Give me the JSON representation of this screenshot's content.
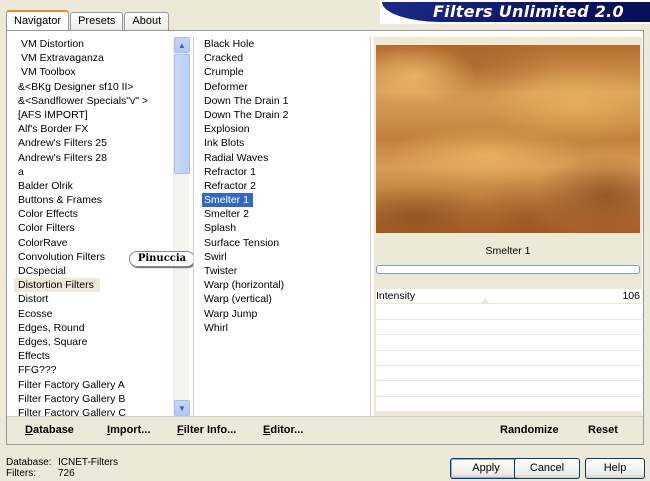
{
  "tabs": [
    "Navigator",
    "Presets",
    "About"
  ],
  "banner": "Filters Unlimited 2.0",
  "categories": [
    "VM Distortion",
    "VM Extravaganza",
    "VM Toolbox",
    "&<BKg Designer sf10 II>",
    "&<Sandflower Specials\"v\" >",
    "[AFS IMPORT]",
    "Alf's Border FX",
    "Andrew's Filters 25",
    "Andrew's Filters 28",
    "a",
    "Balder Olrik",
    "Buttons & Frames",
    "Color Effects",
    "Color Filters",
    "ColorRave",
    "Convolution Filters",
    "DCspecial",
    "Distortion Filters",
    "Distort",
    "Ecosse",
    "Edges, Round",
    "Edges, Square",
    "Effects",
    "FFG???",
    "Filter Factory Gallery A",
    "Filter Factory Gallery B",
    "Filter Factory Gallery C"
  ],
  "category_selected": "Distortion Filters",
  "filters": [
    "Black Hole",
    "Cracked",
    "Crumple",
    "Deformer",
    "Down The Drain 1",
    "Down The Drain 2",
    "Explosion",
    "Ink Blots",
    "Radial Waves",
    "Refractor 1",
    "Refractor 2",
    "Smelter 1",
    "Smelter 2",
    "Splash",
    "Surface Tension",
    "Swirl",
    "Twister",
    "Warp (horizontal)",
    "Warp (vertical)",
    "Warp Jump",
    "Whirl"
  ],
  "filter_selected": "Smelter 1",
  "watermark": "Pinuccia",
  "preview_name": "Smelter 1",
  "sliders": [
    {
      "label": "Intensity",
      "value": "106"
    }
  ],
  "left_buttons": {
    "database": "Database",
    "import": "Import...",
    "filter_info": "Filter Info...",
    "editor": "Editor..."
  },
  "right_buttons": {
    "randomize": "Randomize",
    "reset": "Reset"
  },
  "status": {
    "db_label": "Database:",
    "db_value": "ICNET-Filters",
    "filters_label": "Filters:",
    "filters_value": "726"
  },
  "dialog_buttons": {
    "apply": "Apply",
    "cancel": "Cancel",
    "help": "Help"
  }
}
